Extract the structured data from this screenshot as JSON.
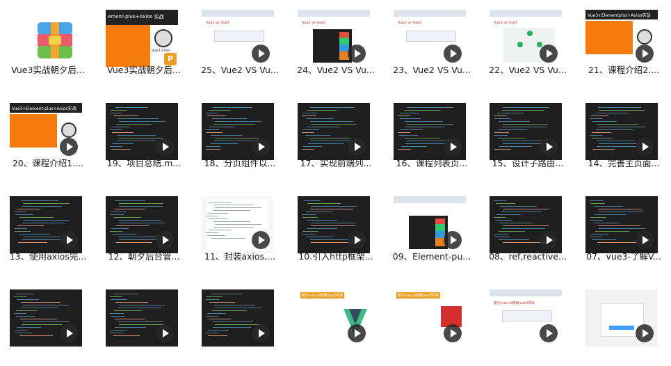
{
  "items": [
    {
      "label": "Vue3实战朝夕后...",
      "kind": "rar"
    },
    {
      "label": "Vue3实战朝夕后...",
      "kind": "ppt",
      "title": "ement-plus+Axios 实战",
      "subtitle": "Vue3 Chan"
    },
    {
      "label": "25、Vue2 VS Vu...",
      "kind": "browser",
      "heading": "Vue2 vs Vue3"
    },
    {
      "label": "24、Vue2 VS Vu...",
      "kind": "browser-code",
      "heading": "Vue2 vs Vue3"
    },
    {
      "label": "23、Vue2 VS Vu...",
      "kind": "browser",
      "heading": "Vue2 vs Vue3"
    },
    {
      "label": "22、Vue2 VS Vu...",
      "kind": "browser-tree",
      "heading": "Vue2 vs Vue3"
    },
    {
      "label": "21、课程介绍2....",
      "kind": "orange",
      "title": "Vue3+Elementplus+Axios实战"
    },
    {
      "label": "20、课程介绍1....",
      "kind": "orange",
      "title": "Vue3+Element-plus+Axios实战"
    },
    {
      "label": "19、项目总结.m...",
      "kind": "code"
    },
    {
      "label": "18、分页组件以...",
      "kind": "code"
    },
    {
      "label": "17、实现前端列...",
      "kind": "code"
    },
    {
      "label": "16、课程列表页...",
      "kind": "code"
    },
    {
      "label": "15、设计子路由...",
      "kind": "code"
    },
    {
      "label": "14、完善主页面...",
      "kind": "code"
    },
    {
      "label": "13、使用axios完...",
      "kind": "code"
    },
    {
      "label": "12、朝夕后台管...",
      "kind": "code"
    },
    {
      "label": "11、封装axios....",
      "kind": "doc"
    },
    {
      "label": "10.引入http框架...",
      "kind": "code"
    },
    {
      "label": "09、Element-pu...",
      "kind": "browser-code"
    },
    {
      "label": "08、ref,reactive...",
      "kind": "code"
    },
    {
      "label": "07、vue3-了解V...",
      "kind": "code"
    },
    {
      "label": "",
      "kind": "code"
    },
    {
      "label": "",
      "kind": "code"
    },
    {
      "label": "",
      "kind": "code"
    },
    {
      "label": "",
      "kind": "vuelogo",
      "heading": "朝夕vue-cli模板Vue3项目"
    },
    {
      "label": "",
      "kind": "red",
      "heading": "朝夕vue-cli模板Vue3项目"
    },
    {
      "label": "",
      "kind": "browser",
      "heading": "朝夕vue-cli模板Vue3项目"
    },
    {
      "label": "",
      "kind": "login"
    }
  ],
  "colors": {
    "orange": "#f47c0f",
    "dark": "#1e1e1e",
    "accent": "#e9a023"
  },
  "icons": {
    "play": "play-icon",
    "rar": "winrar-icon",
    "ppt": "powerpoint-icon"
  }
}
